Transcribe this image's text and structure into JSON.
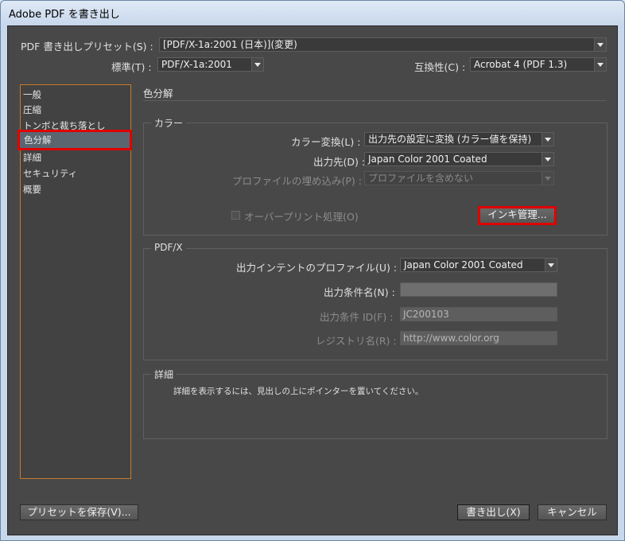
{
  "window": {
    "title": "Adobe PDF を書き出し"
  },
  "top": {
    "preset_label": "PDF 書き出しプリセット(S) :",
    "preset_value": "[PDF/X-1a:2001 (日本)](変更)",
    "standard_label": "標準(T) :",
    "standard_value": "PDF/X-1a:2001",
    "compat_label": "互換性(C) :",
    "compat_value": "Acrobat 4 (PDF 1.3)"
  },
  "sidebar": {
    "items": [
      {
        "label": "一般"
      },
      {
        "label": "圧縮"
      },
      {
        "label": "トンボと裁ち落とし"
      },
      {
        "label": "色分解"
      },
      {
        "label": "詳細"
      },
      {
        "label": "セキュリティ"
      },
      {
        "label": "概要"
      }
    ]
  },
  "main": {
    "section_title": "色分解",
    "color_group": {
      "title": "カラー",
      "conversion_label": "カラー変換(L) :",
      "conversion_value": "出力先の設定に変換 (カラー値を保持)",
      "destination_label": "出力先(D) :",
      "destination_value": "Japan Color 2001 Coated",
      "profile_embed_label": "プロファイルの埋め込み(P) :",
      "profile_embed_value": "プロファイルを含めない",
      "overprint_label": "オーバープリント処理(O)",
      "ink_button": "インキ管理..."
    },
    "pdfx_group": {
      "title": "PDF/X",
      "intent_label": "出力インテントのプロファイル(U) :",
      "intent_value": "Japan Color 2001 Coated",
      "condition_name_label": "出力条件名(N) :",
      "condition_name_value": "",
      "condition_id_label": "出力条件 ID(F) :",
      "condition_id_value": "JC200103",
      "registry_label": "レジストリ名(R) :",
      "registry_value": "http://www.color.org"
    },
    "detail_group": {
      "title": "詳細",
      "text": "詳細を表示するには、見出しの上にポインターを置いてください。"
    }
  },
  "footer": {
    "save_preset": "プリセットを保存(V)...",
    "export": "書き出し(X)",
    "cancel": "キャンセル"
  }
}
